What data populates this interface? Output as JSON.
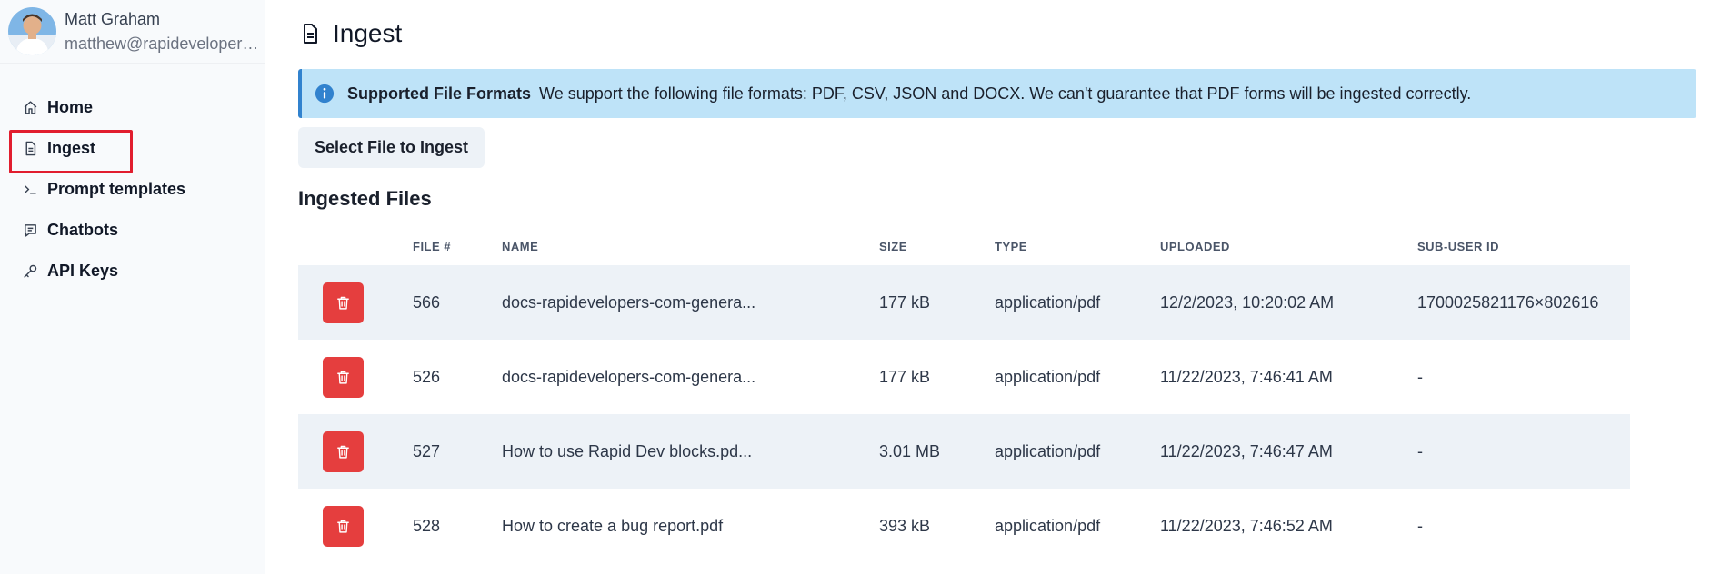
{
  "user": {
    "name": "Matt Graham",
    "email": "matthew@rapidevelopers.com"
  },
  "nav": {
    "items": [
      {
        "label": "Home",
        "icon": "home-icon"
      },
      {
        "label": "Ingest",
        "icon": "file-icon",
        "active": true
      },
      {
        "label": "Prompt templates",
        "icon": "terminal-icon"
      },
      {
        "label": "Chatbots",
        "icon": "chat-icon"
      },
      {
        "label": "API Keys",
        "icon": "key-icon"
      }
    ]
  },
  "page": {
    "title": "Ingest"
  },
  "alert": {
    "title": "Supported File Formats",
    "description": "We support the following file formats: PDF, CSV, JSON and DOCX. We can't guarantee that PDF forms will be ingested correctly.",
    "icon": "info-icon",
    "color": "#bee3f8"
  },
  "actions": {
    "select_file_label": "Select File to Ingest"
  },
  "files": {
    "title": "Ingested Files",
    "headers": {
      "file_no": "File #",
      "name": "Name",
      "size": "Size",
      "type": "Type",
      "uploaded": "Uploaded",
      "sub_user_id": "Sub-User ID"
    },
    "rows": [
      {
        "file_no": "566",
        "name": "docs-rapidevelopers-com-genera...",
        "size": "177 kB",
        "type": "application/pdf",
        "uploaded": "12/2/2023, 10:20:02 AM",
        "sub_user_id": "1700025821176×802616"
      },
      {
        "file_no": "526",
        "name": "docs-rapidevelopers-com-genera...",
        "size": "177 kB",
        "type": "application/pdf",
        "uploaded": "11/22/2023, 7:46:41 AM",
        "sub_user_id": "-"
      },
      {
        "file_no": "527",
        "name": "How to use Rapid Dev blocks.pd...",
        "size": "3.01 MB",
        "type": "application/pdf",
        "uploaded": "11/22/2023, 7:46:47 AM",
        "sub_user_id": "-"
      },
      {
        "file_no": "528",
        "name": "How to create a bug report.pdf",
        "size": "393 kB",
        "type": "application/pdf",
        "uploaded": "11/22/2023, 7:46:52 AM",
        "sub_user_id": "-"
      }
    ],
    "delete_color": "#e53e3e"
  }
}
